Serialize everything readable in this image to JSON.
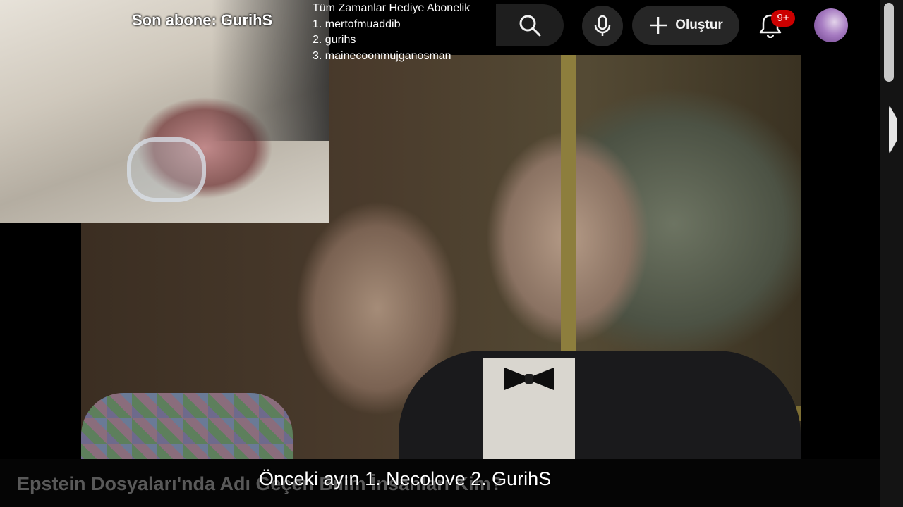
{
  "overlay": {
    "last_subscriber": "Son abone: GurihS",
    "leaderboard": {
      "title": "Tüm Zamanlar Hediye  Abonelik",
      "entries": [
        "1. mertofmuaddib",
        "2. gurihs",
        "3. mainecoonmujganosman"
      ]
    }
  },
  "topbar": {
    "create_label": "Oluştur",
    "notification_badge": "9+",
    "icons": [
      "search-icon",
      "microphone-icon",
      "plus-icon",
      "bell-icon"
    ]
  },
  "video": {
    "title": "Epstein Dosyaları'nda Adı Geçen Bilim İnsanları Kim?",
    "subtitle": "Önceki ayın 1. Necolove 2. GurihS"
  },
  "colors": {
    "badge": "#cc0000",
    "control_bg": "#262626",
    "title_text": "#595959"
  }
}
